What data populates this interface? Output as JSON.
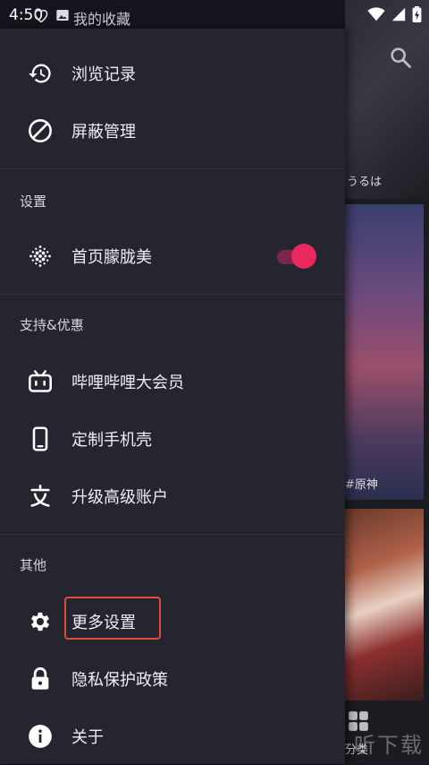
{
  "status_bar": {
    "time": "4:50"
  },
  "header": {
    "title": "我的收藏"
  },
  "history": {
    "label": "浏览记录"
  },
  "block": {
    "label": "屏蔽管理"
  },
  "settings_section": {
    "title": "设置",
    "blur_home": {
      "label": "首页朦胧美",
      "enabled": true
    }
  },
  "support_section": {
    "title": "支持&优惠",
    "items": [
      {
        "label": "哔哩哔哩大会员",
        "icon": "bilibili-tv-icon"
      },
      {
        "label": "定制手机壳",
        "icon": "phone-icon"
      },
      {
        "label": "升级高级账户",
        "icon": "upgrade-icon"
      }
    ]
  },
  "other_section": {
    "title": "其他",
    "items": [
      {
        "label": "更多设置",
        "icon": "gear-icon"
      },
      {
        "label": "隐私保护政策",
        "icon": "lock-icon"
      },
      {
        "label": "关于",
        "icon": "info-icon"
      }
    ]
  },
  "background": {
    "caption": "うるは",
    "tag": "#原神",
    "bottom_label": "分类"
  },
  "watermark": "一听下载",
  "colors": {
    "accent": "#e8285e",
    "drawer_bg": "#25252f",
    "highlight": "#e14a3d"
  }
}
